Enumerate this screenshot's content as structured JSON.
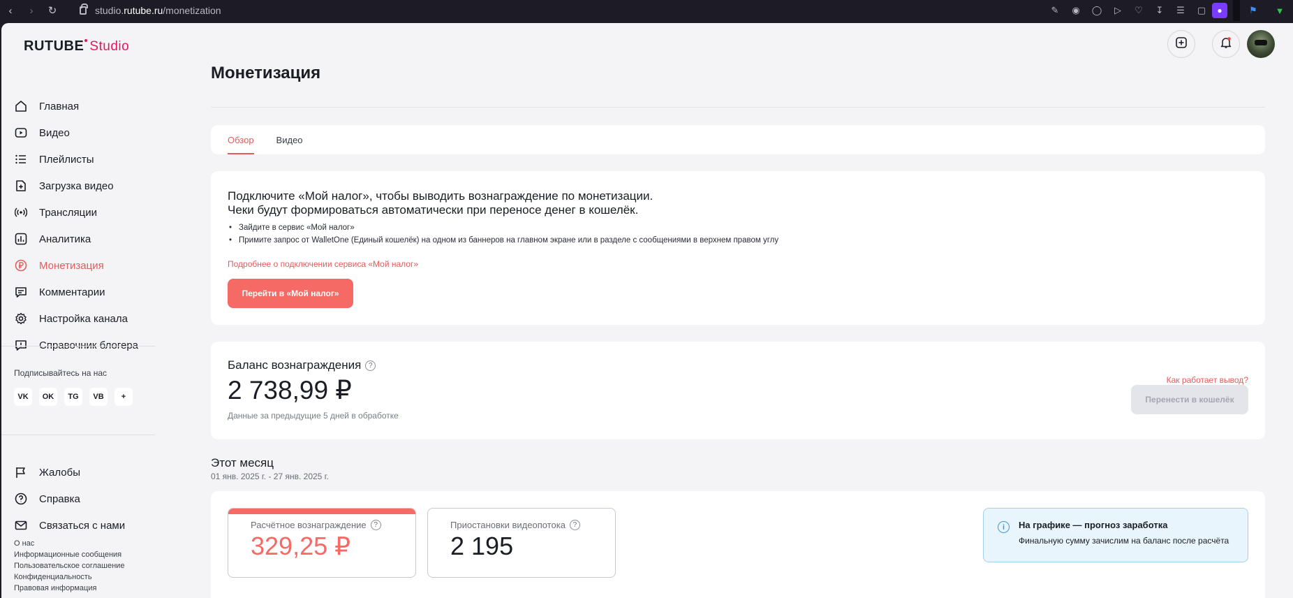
{
  "browser": {
    "url_prefix": "studio.",
    "url_domain": "rutube.ru",
    "url_path": "/monetization"
  },
  "brand": {
    "name": "RUTUBE",
    "product": "Studio",
    "accent": "#e4175b"
  },
  "sidebar": {
    "items": [
      {
        "label": "Главная",
        "icon": "home-icon"
      },
      {
        "label": "Видео",
        "icon": "video-icon"
      },
      {
        "label": "Плейлисты",
        "icon": "playlist-icon"
      },
      {
        "label": "Загрузка видео",
        "icon": "upload-icon"
      },
      {
        "label": "Трансляции",
        "icon": "broadcast-icon"
      },
      {
        "label": "Аналитика",
        "icon": "analytics-icon"
      },
      {
        "label": "Монетизация",
        "icon": "ruble-icon",
        "active": true
      },
      {
        "label": "Комментарии",
        "icon": "comment-icon"
      },
      {
        "label": "Настройка канала",
        "icon": "gear-icon"
      },
      {
        "label": "Справочник блогера",
        "icon": "guide-icon"
      }
    ],
    "follow_label": "Подписывайтесь на нас",
    "socials": [
      {
        "label": "VK",
        "icon": "vk-icon"
      },
      {
        "label": "OK",
        "icon": "ok-icon"
      },
      {
        "label": "TG",
        "icon": "telegram-icon"
      },
      {
        "label": "VB",
        "icon": "viber-icon"
      },
      {
        "label": "+",
        "icon": "plus-icon"
      }
    ],
    "secondary": [
      {
        "label": "Жалобы",
        "icon": "flag-icon"
      },
      {
        "label": "Справка",
        "icon": "help-icon"
      },
      {
        "label": "Связаться с нами",
        "icon": "mail-icon"
      }
    ],
    "footer": [
      "О нас",
      "Информационные сообщения",
      "Пользовательское соглашение",
      "Конфиденциальность",
      "Правовая информация"
    ]
  },
  "page": {
    "title": "Монетизация",
    "tabs": [
      {
        "label": "Обзор",
        "active": true
      },
      {
        "label": "Видео",
        "active": false
      }
    ]
  },
  "tax_card": {
    "heading_line1": "Подключите «Мой налог», чтобы выводить вознаграждение по монетизации.",
    "heading_line2": "Чеки будут формироваться автоматически при переносе денег в кошелёк.",
    "steps": [
      "Зайдите в сервис «Мой налог»",
      "Примите запрос от WalletOne (Единый кошелёк) на одном из баннеров на главном экране или в разделе с сообщениями в верхнем правом углу"
    ],
    "more_link": "Подробнее о подключении сервиса «Мой налог»",
    "button": "Перейти в «Мой налог»"
  },
  "balance": {
    "label": "Баланс вознаграждения",
    "amount": "2 738,99 ₽",
    "note": "Данные за предыдущие 5 дней в обработке",
    "how_link": "Как работает вывод?",
    "transfer_button": "Перенести в кошелёк"
  },
  "month": {
    "title": "Этот месяц",
    "range": "01 янв. 2025 г. - 27 янв. 2025 г.",
    "stats": [
      {
        "label": "Расчётное вознаграждение",
        "value": "329,25 ₽"
      },
      {
        "label": "Приостановки видеопотока",
        "value": "2 195"
      }
    ],
    "info_title": "На графике — прогноз заработка",
    "info_text": "Финальную сумму зачислим на баланс после расчёта"
  },
  "colors": {
    "accent": "#f66a66",
    "link": "#e25c5c",
    "info_border": "#9fd2ef"
  }
}
